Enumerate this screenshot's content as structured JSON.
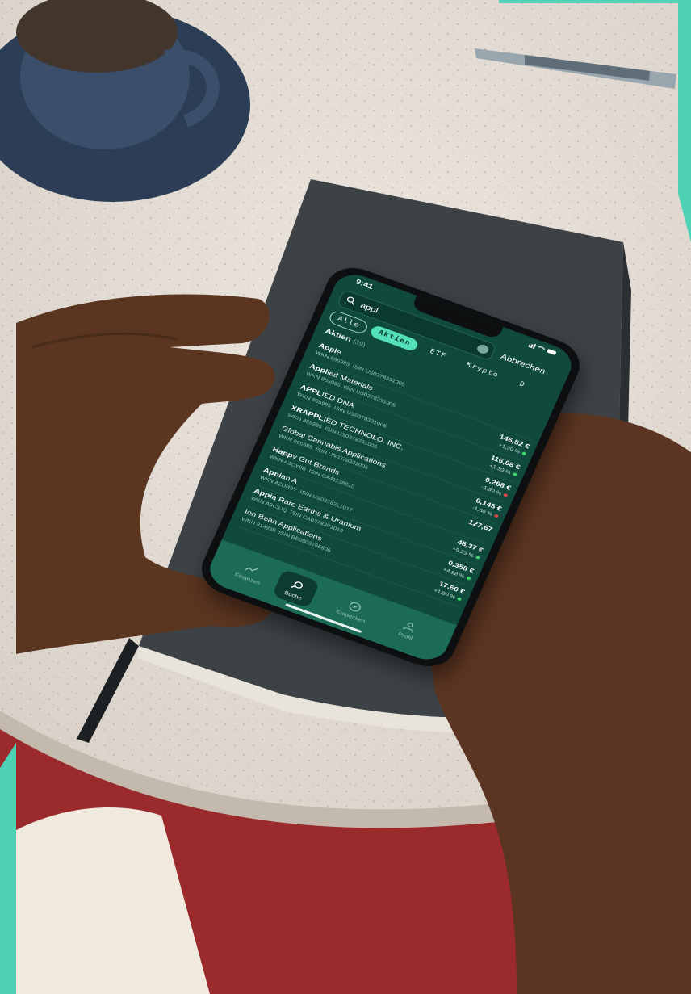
{
  "status_bar": {
    "time": "9:41"
  },
  "search": {
    "query": "appl",
    "cancel_label": "Abbrechen"
  },
  "tabs": [
    {
      "label": "Alle",
      "state": "outline"
    },
    {
      "label": "Aktien",
      "state": "active"
    },
    {
      "label": "ETF",
      "state": "plain"
    },
    {
      "label": "Krypto",
      "state": "plain"
    },
    {
      "label": "D",
      "state": "plain"
    }
  ],
  "section": {
    "title": "Aktien",
    "count": "(39)"
  },
  "results": [
    {
      "name_bold": "Appl",
      "name_rest": "e",
      "wkn": "WKN 865985",
      "isin": "ISIN US0378331005",
      "price": "",
      "change": "",
      "trend": ""
    },
    {
      "name_bold": "Appl",
      "name_rest": "ied Materials",
      "wkn": "WKN 865985",
      "isin": "ISIN US0378331005",
      "price": "146,52 €",
      "change": "+1,30 %",
      "trend": "up"
    },
    {
      "name_bold": "APPL",
      "name_rest": "IED DNA",
      "wkn": "WKN 865985",
      "isin": "ISIN US0378331005",
      "price": "116,08 €",
      "change": "+1,30 %",
      "trend": "up"
    },
    {
      "name_bold": "XRAPPL",
      "name_rest": "IED TECHNOLO. INC.",
      "wkn": "WKN 865985",
      "isin": "ISIN US0378331005",
      "price": "0,268 €",
      "change": "-1,30 %",
      "trend": "down"
    },
    {
      "name_bold": "",
      "name_rest": "Global Cannabis Applications",
      "wkn": "WKN 865985",
      "isin": "ISIN US0378331005",
      "price": "0,145 €",
      "change": "-1,30 %",
      "trend": "down"
    },
    {
      "name_bold": "Happ",
      "name_rest": "y Gut Brands",
      "wkn": "WKN A3CY9B",
      "isin": "ISIN CA41136810",
      "price": "127,67",
      "change": "",
      "trend": ""
    },
    {
      "name_bold": "Appi",
      "name_rest": "an A",
      "wkn": "WKN A2DR9Y",
      "isin": "ISIN US03782L1017",
      "price": "48,37 €",
      "change": "+5,23 %",
      "trend": "up"
    },
    {
      "name_bold": "Appi",
      "name_rest": "a Rare Earths & Uranium",
      "wkn": "WKN A3C3JQ",
      "isin": "ISIN CA03783P1018",
      "price": "0,358 €",
      "change": "+4,28 %",
      "trend": "up"
    },
    {
      "name_bold": "",
      "name_rest": "Ion Bean Applications",
      "wkn": "WKN 914998",
      "isin": "ISIN BE0003766806",
      "price": "17,60 €",
      "change": "+1,90 %",
      "trend": "up"
    }
  ],
  "tab_bar": [
    {
      "label": "Finanzen",
      "icon": "chart-icon",
      "active": false
    },
    {
      "label": "Suche",
      "icon": "search-icon",
      "active": true
    },
    {
      "label": "Entdecken",
      "icon": "compass-icon",
      "active": false
    },
    {
      "label": "Profil",
      "icon": "profile-icon",
      "active": false
    }
  ],
  "colors": {
    "screen_bg": "#0f4a3c",
    "accent": "#54e0b9",
    "frame_accent": "#4fd1b5",
    "up": "#3fd46b",
    "down": "#e0484a"
  }
}
